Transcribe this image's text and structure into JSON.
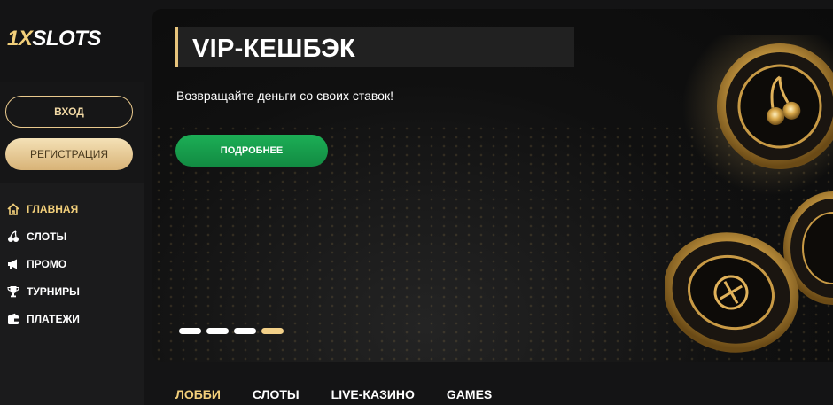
{
  "logo": {
    "part1": "1X",
    "part2": "SLOTS"
  },
  "auth": {
    "login_label": "ВХОД",
    "register_label": "РЕГИСТРАЦИЯ"
  },
  "nav": [
    {
      "label": "ГЛАВНАЯ",
      "icon": "home-icon",
      "active": true
    },
    {
      "label": "СЛОТЫ",
      "icon": "cherry-icon",
      "active": false
    },
    {
      "label": "ПРОМО",
      "icon": "megaphone-icon",
      "active": false
    },
    {
      "label": "ТУРНИРЫ",
      "icon": "trophy-icon",
      "active": false
    },
    {
      "label": "ПЛАТЕЖИ",
      "icon": "wallet-icon",
      "active": false
    }
  ],
  "banner": {
    "title": "VIP-КЕШБЭК",
    "subtitle": "Возвращайте деньги со своих ставок!",
    "button_label": "ПОДРОБНЕЕ",
    "slides_total": 4,
    "slide_active": 4
  },
  "tabs": [
    {
      "label": "ЛОББИ",
      "active": true
    },
    {
      "label": "СЛОТЫ",
      "active": false
    },
    {
      "label": "LIVE-КАЗИНО",
      "active": false
    },
    {
      "label": "GAMES",
      "active": false
    }
  ],
  "colors": {
    "accent_gold": "#f2cf7a",
    "button_green": "#1cae56",
    "sidebar_bg": "#1b1b1c"
  }
}
